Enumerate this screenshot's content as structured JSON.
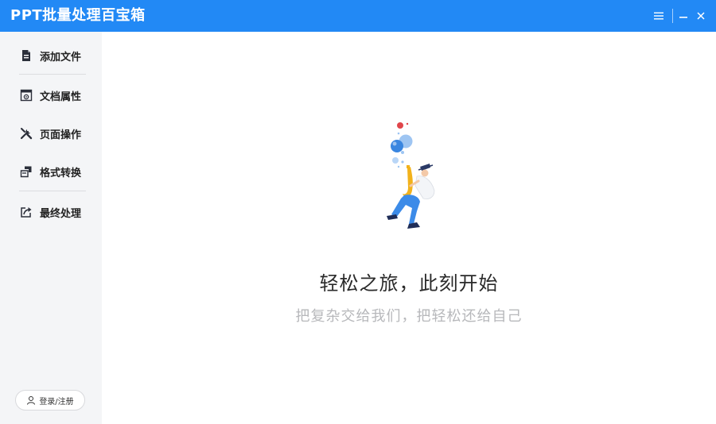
{
  "app": {
    "title": "PPT批量处理百宝箱"
  },
  "titlebar": {
    "menu_icon": "hamburger-menu-icon",
    "minimize_icon": "minimize-icon",
    "close_icon": "close-icon"
  },
  "sidebar": {
    "items": [
      {
        "label": "添加文件",
        "icon": "add-file-icon"
      },
      {
        "label": "文档属性",
        "icon": "document-properties-icon"
      },
      {
        "label": "页面操作",
        "icon": "tools-icon"
      },
      {
        "label": "格式转换",
        "icon": "format-convert-icon"
      },
      {
        "label": "最终处理",
        "icon": "export-share-icon"
      }
    ],
    "login_label": "登录/注册"
  },
  "main": {
    "headline": "轻松之旅，此刻开始",
    "subline": "把复杂交给我们，把轻松还给自己",
    "illustration_icon": "saxophone-player-illustration"
  },
  "colors": {
    "accent": "#2289f5",
    "sidebar_bg": "#f4f5f7",
    "subline": "#b7b8bb"
  }
}
